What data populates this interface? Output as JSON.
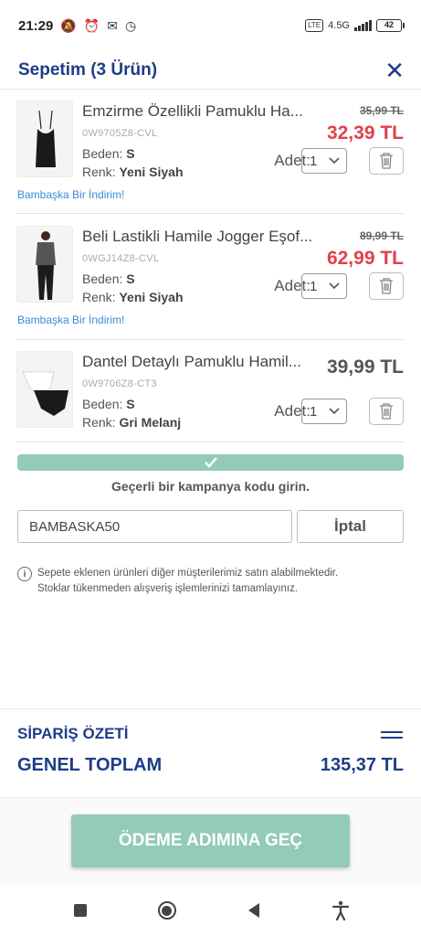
{
  "status_bar": {
    "time": "21:29",
    "network": "4.5G",
    "lte": "LTE",
    "battery": "42",
    "battery_level": 0.42
  },
  "header": {
    "title": "Sepetim (3 Ürün)"
  },
  "items": [
    {
      "name": "Emzirme Özellikli Pamuklu Ha...",
      "sku": "0W9705Z8-CVL",
      "size_label": "Beden:",
      "size": "S",
      "color_label": "Renk:",
      "color": "Yeni Siyah",
      "old_price": "35,99 TL",
      "price": "32,39 TL",
      "qty_label": "Adet:",
      "qty": "1",
      "promo": "Bambaşka Bir İndirim!"
    },
    {
      "name": "Beli Lastikli Hamile Jogger Eşof...",
      "sku": "0WGJ14Z8-CVL",
      "size_label": "Beden:",
      "size": "S",
      "color_label": "Renk:",
      "color": "Yeni Siyah",
      "old_price": "89,99 TL",
      "price": "62,99 TL",
      "qty_label": "Adet:",
      "qty": "1",
      "promo": "Bambaşka Bir İndirim!"
    },
    {
      "name": "Dantel Detaylı Pamuklu Hamil...",
      "sku": "0W9706Z8-CT3",
      "size_label": "Beden:",
      "size": "S",
      "color_label": "Renk:",
      "color": "Gri Melanj",
      "price": "39,99 TL",
      "qty_label": "Adet:",
      "qty": "1"
    }
  ],
  "campaign": {
    "message": "Geçerli bir kampanya kodu girin.",
    "code_value": "BAMBASKA50",
    "cancel_label": "İptal"
  },
  "info": {
    "line1": "Sepete eklenen ürünleri diğer müşterilerimiz satın alabilmektedir.",
    "line2": "Stoklar tükenmeden alışveriş işlemlerinizi tamamlayınız."
  },
  "summary": {
    "title": "SİPARİŞ ÖZETİ",
    "total_label": "GENEL TOPLAM",
    "total_value": "135,37 TL"
  },
  "checkout": {
    "label": "ÖDEME ADIMINA GEÇ"
  },
  "colors": {
    "brand": "#1f3c88",
    "sale": "#e3404a",
    "accent_green": "#93cbb7",
    "link": "#3b8ad8"
  }
}
